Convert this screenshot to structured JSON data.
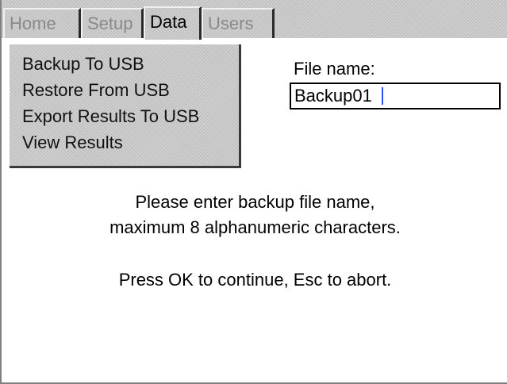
{
  "tabs": {
    "home": "Home",
    "setup": "Setup",
    "data": "Data",
    "users": "Users"
  },
  "menu": {
    "items": [
      "Backup To USB",
      "Restore From USB",
      "Export Results To USB",
      "View Results"
    ]
  },
  "file": {
    "label": "File name:",
    "value": "Backup01"
  },
  "message": {
    "line1": "Please enter backup file name,",
    "line2": "maximum 8 alphanumeric characters.",
    "line3": "Press OK to continue, Esc to abort."
  },
  "colors": {
    "caret": "#2b56ff",
    "panel": "#c8c8c8",
    "inactive_tab_text": "#8a8a8a"
  }
}
